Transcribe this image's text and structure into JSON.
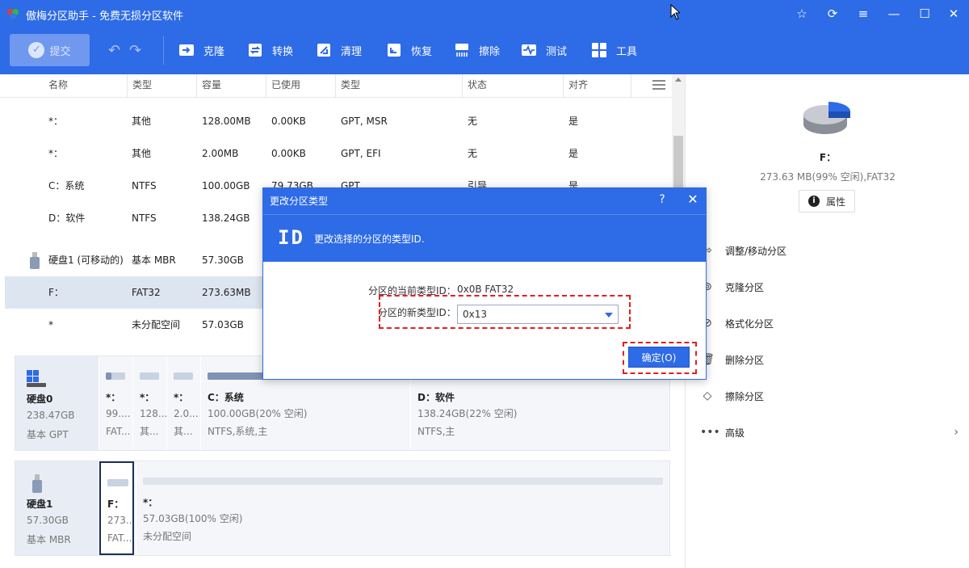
{
  "app": {
    "title": "傲梅分区助手 - 免费无损分区软件"
  },
  "titlebar_buttons": [
    "star-icon",
    "refresh-icon",
    "menu-icon",
    "minimize-icon",
    "maximize-icon",
    "close-icon"
  ],
  "toolbar": {
    "commit": "提交",
    "clone": "克隆",
    "convert": "转换",
    "clean": "清理",
    "recover": "恢复",
    "wipe": "擦除",
    "test": "测试",
    "tools": "工具"
  },
  "table": {
    "headers": [
      "名称",
      "类型",
      "容量",
      "已使用",
      "类型",
      "状态",
      "对齐"
    ],
    "rows": [
      {
        "name": "*：",
        "type": "其他",
        "cap": "128.00MB",
        "used": "0.00KB",
        "fs": "GPT, MSR",
        "status": "无",
        "align": "是"
      },
      {
        "name": "*：",
        "type": "其他",
        "cap": "2.00MB",
        "used": "0.00KB",
        "fs": "GPT, EFI",
        "status": "无",
        "align": "是"
      },
      {
        "name": "C：系统",
        "type": "NTFS",
        "cap": "100.00GB",
        "used": "79.73GB",
        "fs": "GPT",
        "status": "引导",
        "align": "是"
      },
      {
        "name": "D：软件",
        "type": "NTFS",
        "cap": "138.24GB",
        "used": "",
        "fs": "",
        "status": "",
        "align": ""
      },
      {
        "name": "硬盘1 (可移动的)",
        "type": "基本 MBR",
        "cap": "57.30GB",
        "used": "",
        "fs": "",
        "status": "",
        "align": ""
      },
      {
        "name": "F：",
        "type": "FAT32",
        "cap": "273.63MB",
        "used": "",
        "fs": "",
        "status": "",
        "align": ""
      },
      {
        "name": "*",
        "type": "未分配空间",
        "cap": "57.03GB",
        "used": "",
        "fs": "",
        "status": "",
        "align": ""
      }
    ]
  },
  "disks": {
    "disk0": {
      "name": "硬盘0",
      "size": "238.47GB",
      "kind": "基本 GPT",
      "parts": [
        {
          "name": "*：",
          "sub1": "99....",
          "sub2": "FAT...",
          "fill": 0.3
        },
        {
          "name": "*：",
          "sub1": "128...",
          "sub2": "其...",
          "fill": 0.0
        },
        {
          "name": "*：",
          "sub1": "2.0...",
          "sub2": "其...",
          "fill": 0.0
        },
        {
          "name": "C：系统",
          "sub1": "100.00GB(20% 空闲)",
          "sub2": "NTFS,系统,主",
          "fill": 0.8
        },
        {
          "name": "D：软件",
          "sub1": "138.24GB(22% 空闲)",
          "sub2": "NTFS,主",
          "fill": 0.78
        }
      ]
    },
    "disk1": {
      "name": "硬盘1",
      "size": "57.30GB",
      "kind": "基本 MBR",
      "parts": [
        {
          "name": "F：",
          "sub1": "273...",
          "sub2": "FAT...",
          "fill": 0.0
        },
        {
          "name": "*：",
          "sub1": "57.03GB(100% 空闲)",
          "sub2": "未分配空间",
          "fill": 0.0
        }
      ]
    }
  },
  "right": {
    "drive": "F：",
    "info": "273.63 MB(99% 空闲),FAT32",
    "props": "属性",
    "ops": [
      "调整/移动分区",
      "克隆分区",
      "格式化分区",
      "删除分区",
      "擦除分区",
      "高级"
    ]
  },
  "dialog": {
    "title": "更改分区类型",
    "help": "?",
    "close": "✕",
    "id_icon": "ID",
    "desc": "更改选择的分区的类型ID.",
    "cur_label": "分区的当前类型ID：",
    "cur_value": "0x0B FAT32",
    "new_label": "分区的新类型ID：",
    "new_value": "0x13",
    "ok": "确定(O)"
  },
  "colors": {
    "brand": "#2e6be6",
    "highlight": "#e02020"
  }
}
